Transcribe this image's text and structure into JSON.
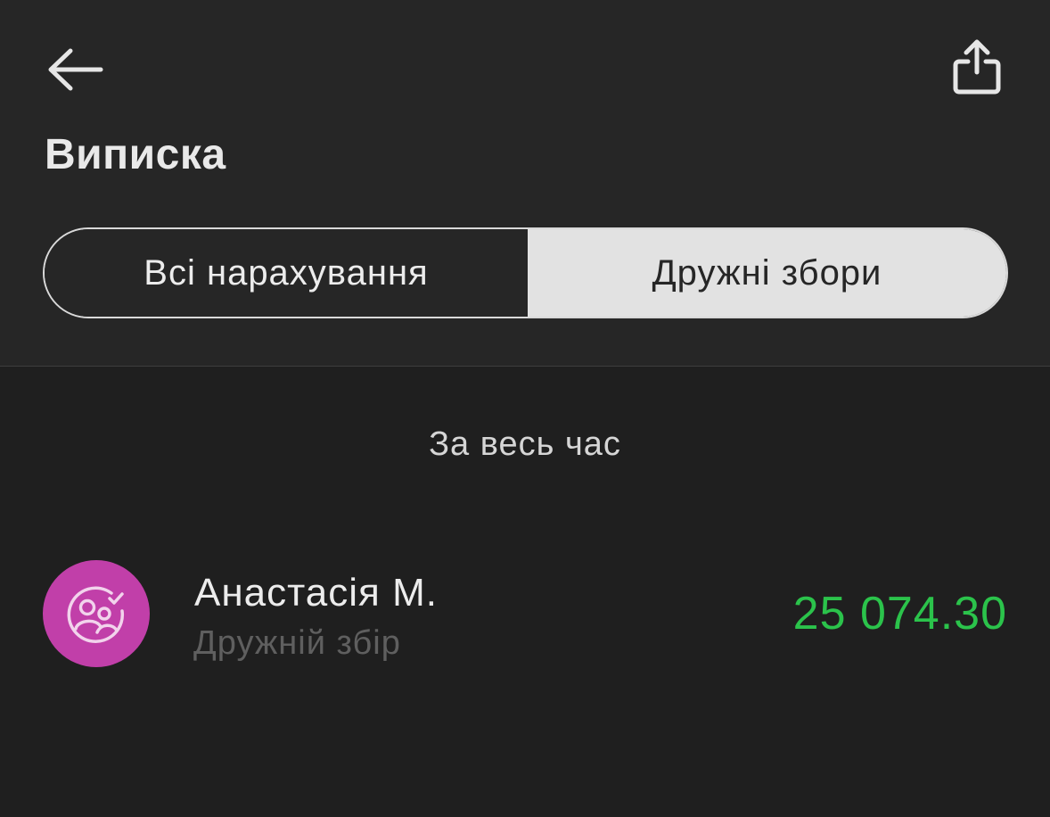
{
  "header": {
    "title": "Виписка",
    "back_icon": "arrow-left-icon",
    "share_icon": "share-icon"
  },
  "tabs": [
    {
      "label": "Всі нарахування",
      "selected": false
    },
    {
      "label": "Дружні збори",
      "selected": true
    }
  ],
  "period_label": "За весь час",
  "transactions": [
    {
      "name": "Анастасія М.",
      "subtitle": "Дружній збір",
      "amount": "25 074.30",
      "icon": "group-check-icon",
      "avatar_color": "#c13fa9",
      "amount_color": "#2bc34b"
    }
  ]
}
